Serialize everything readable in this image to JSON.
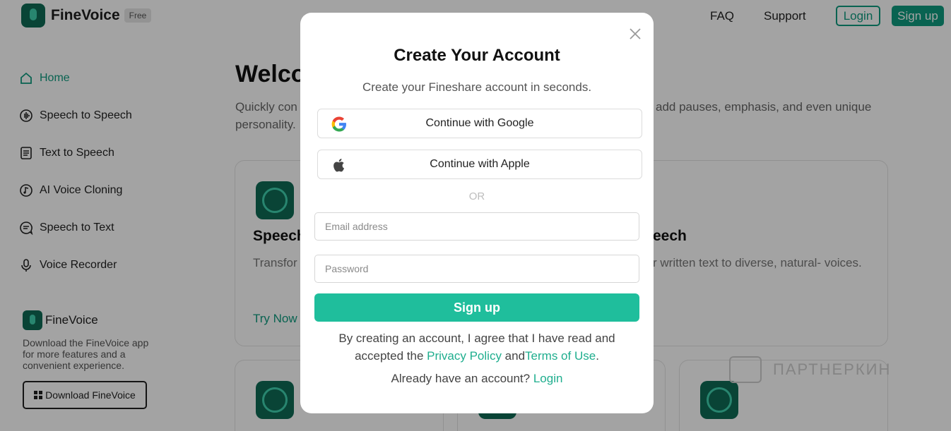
{
  "app": {
    "name": "FineVoice",
    "badge": "Free"
  },
  "topnav": {
    "faq": "FAQ",
    "support": "Support",
    "login": "Login",
    "signup": "Sign up"
  },
  "sidebar": {
    "items": [
      {
        "label": "Home",
        "icon": "home-icon",
        "active": true
      },
      {
        "label": "Speech to Speech",
        "icon": "voice-wave-icon"
      },
      {
        "label": "Text to Speech",
        "icon": "document-icon"
      },
      {
        "label": "AI Voice Cloning",
        "icon": "music-note-icon"
      },
      {
        "label": "Speech to Text",
        "icon": "chat-icon"
      },
      {
        "label": "Voice Recorder",
        "icon": "microphone-icon"
      }
    ]
  },
  "promo": {
    "title": "FineVoice",
    "description": "Download the FineVoice app for more features and a convenient experience.",
    "download_label": "Download FineVoice"
  },
  "main": {
    "welcome": "Welco",
    "intro_left": "Quickly con personality.",
    "intro_right": "add pauses, emphasis, and even unique",
    "card_left_title": "Speech",
    "card_left_desc": "Transfor favorite",
    "card_right_title": "eech",
    "card_right_desc": "r written text to diverse, natural- voices.",
    "try_now": "Try Now"
  },
  "watermark": "ПАРТНЕРКИН",
  "modal": {
    "title": "Create Your Account",
    "subtitle": "Create your Fineshare account in seconds.",
    "google_label": "Continue with Google",
    "apple_label": "Continue with Apple",
    "or": "OR",
    "email_placeholder": "Email address",
    "password_placeholder": "Password",
    "signup_label": "Sign up",
    "consent_prefix": "By creating an account, I agree that I have read and accepted the ",
    "privacy_policy": "Privacy Policy",
    "consent_and": " and",
    "terms": "Terms of Use",
    "consent_suffix": ".",
    "have_account": "Already have an account? ",
    "login_link": "Login"
  },
  "colors": {
    "accent": "#1fbe9c",
    "brand_dark": "#0f6b55",
    "link": "#1fae8e"
  }
}
